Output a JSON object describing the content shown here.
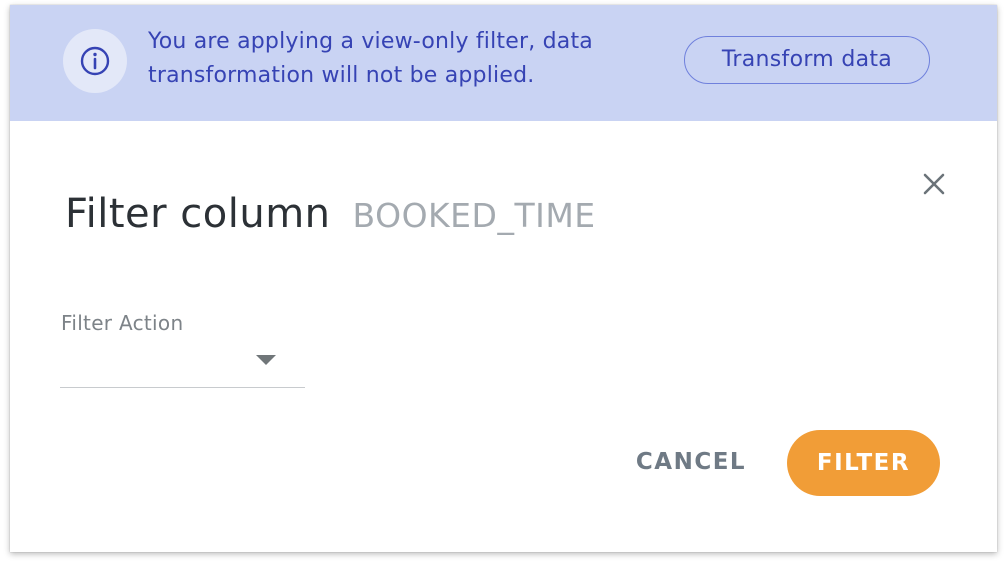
{
  "banner": {
    "icon": "info-icon",
    "message": "You are applying a view-only filter, data transformation will not be applied.",
    "action_label": "Transform data",
    "background_color": "#c9d3f3",
    "text_color": "#3643b4"
  },
  "dialog": {
    "title": "Filter column",
    "column_name": "BOOKED_TIME",
    "close_icon": "close-icon"
  },
  "form": {
    "filter_action": {
      "label": "Filter Action",
      "value": "",
      "icon": "dropdown-arrow-icon"
    }
  },
  "actions": {
    "cancel_label": "CANCEL",
    "filter_label": "FILTER",
    "primary_color": "#f19d37"
  }
}
